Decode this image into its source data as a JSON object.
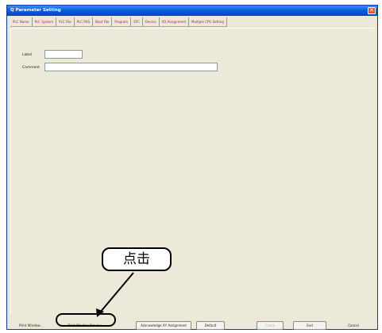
{
  "window": {
    "title": "Q Parameter Setting"
  },
  "tabs": [
    "PLC Name",
    "PLC System",
    "PLC File",
    "PLC RAS",
    "Boot File",
    "Program",
    "SFC",
    "Device",
    "I/O Assignment",
    "Multiple CPU Setting"
  ],
  "form": {
    "label_label": "Label",
    "label_value": "",
    "comment_label": "Comment",
    "comment_value": ""
  },
  "callout": {
    "text": "点击"
  },
  "buttons": {
    "print_window": "Print Window...",
    "print_window_preview": "Print Window Preview",
    "acknowledge_xy": "Acknowledge XY Assignment",
    "default": "Default",
    "check": "Check",
    "end": "End",
    "cancel": "Cancel"
  },
  "colors": {
    "title_bar": "#0b5fdc",
    "tab_text": "#b01860",
    "callout_border": "#000000"
  }
}
